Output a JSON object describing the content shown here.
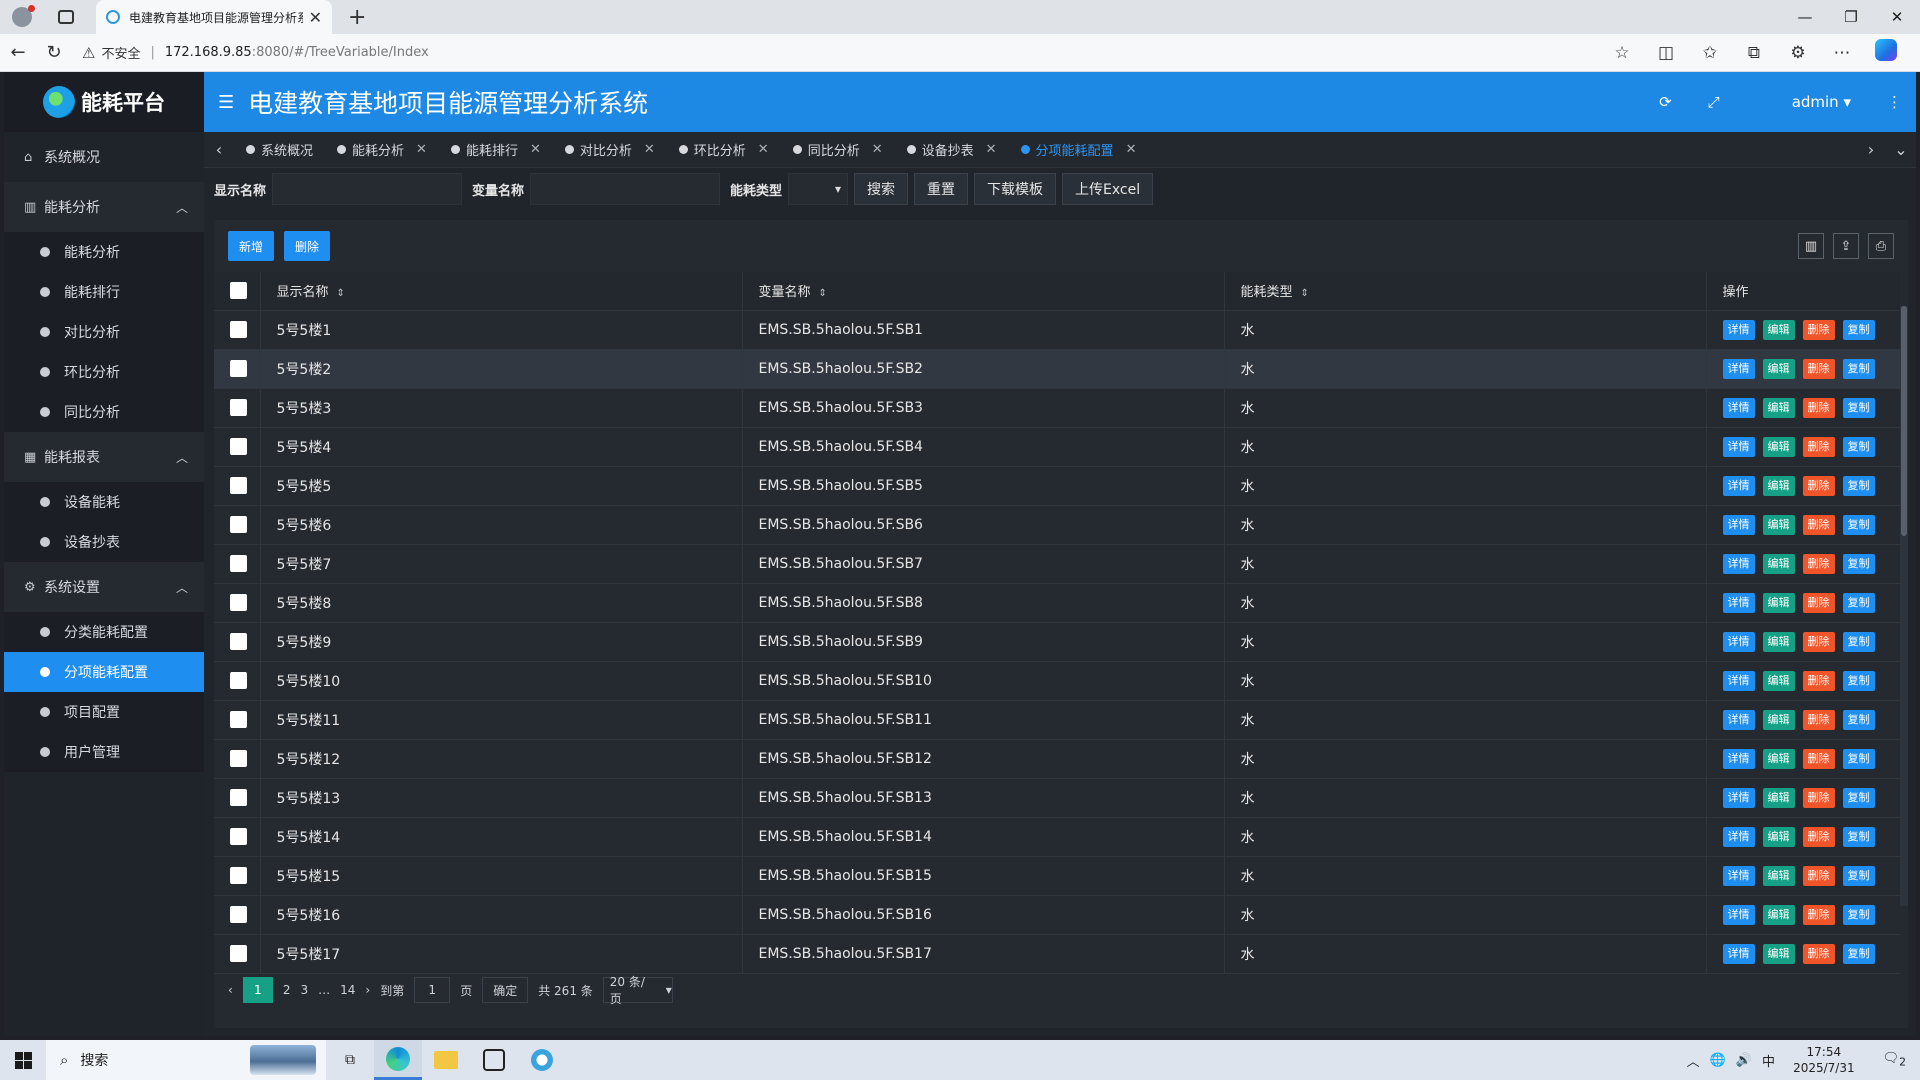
{
  "browser": {
    "tab_title": "电建教育基地项目能源管理分析系",
    "new_tab": "+",
    "security_text": "不安全",
    "url_host": "172.168.9.85",
    "url_path": ":8080/#/TreeVariable/Index"
  },
  "app": {
    "logo_text": "能耗平台",
    "system_title": "电建教育基地项目能源管理分析系统",
    "user": "admin"
  },
  "sidebar": {
    "overview": "系统概况",
    "group_analysis": "能耗分析",
    "analysis_items": [
      "能耗分析",
      "能耗排行",
      "对比分析",
      "环比分析",
      "同比分析"
    ],
    "group_report": "能耗报表",
    "report_items": [
      "设备能耗",
      "设备抄表"
    ],
    "group_settings": "系统设置",
    "settings_items": [
      "分类能耗配置",
      "分项能耗配置",
      "项目配置",
      "用户管理"
    ]
  },
  "tags": [
    "系统概况",
    "能耗分析",
    "能耗排行",
    "对比分析",
    "环比分析",
    "同比分析",
    "设备抄表",
    "分项能耗配置"
  ],
  "search": {
    "display_name_label": "显示名称",
    "variable_name_label": "变量名称",
    "energy_type_label": "能耗类型",
    "search_btn": "搜索",
    "reset_btn": "重置",
    "download_btn": "下载模板",
    "upload_btn": "上传Excel"
  },
  "toolbar": {
    "add_btn": "新增",
    "delete_btn": "删除"
  },
  "table": {
    "headers": [
      "显示名称",
      "变量名称",
      "能耗类型",
      "操作"
    ],
    "ops": [
      "详情",
      "编辑",
      "删除",
      "复制"
    ],
    "rows": [
      [
        "5号5楼1",
        "EMS.SB.5haolou.5F.SB1",
        "水"
      ],
      [
        "5号5楼2",
        "EMS.SB.5haolou.5F.SB2",
        "水"
      ],
      [
        "5号5楼3",
        "EMS.SB.5haolou.5F.SB3",
        "水"
      ],
      [
        "5号5楼4",
        "EMS.SB.5haolou.5F.SB4",
        "水"
      ],
      [
        "5号5楼5",
        "EMS.SB.5haolou.5F.SB5",
        "水"
      ],
      [
        "5号5楼6",
        "EMS.SB.5haolou.5F.SB6",
        "水"
      ],
      [
        "5号5楼7",
        "EMS.SB.5haolou.5F.SB7",
        "水"
      ],
      [
        "5号5楼8",
        "EMS.SB.5haolou.5F.SB8",
        "水"
      ],
      [
        "5号5楼9",
        "EMS.SB.5haolou.5F.SB9",
        "水"
      ],
      [
        "5号5楼10",
        "EMS.SB.5haolou.5F.SB10",
        "水"
      ],
      [
        "5号5楼11",
        "EMS.SB.5haolou.5F.SB11",
        "水"
      ],
      [
        "5号5楼12",
        "EMS.SB.5haolou.5F.SB12",
        "水"
      ],
      [
        "5号5楼13",
        "EMS.SB.5haolou.5F.SB13",
        "水"
      ],
      [
        "5号5楼14",
        "EMS.SB.5haolou.5F.SB14",
        "水"
      ],
      [
        "5号5楼15",
        "EMS.SB.5haolou.5F.SB15",
        "水"
      ],
      [
        "5号5楼16",
        "EMS.SB.5haolou.5F.SB16",
        "水"
      ],
      [
        "5号5楼17",
        "EMS.SB.5haolou.5F.SB17",
        "水"
      ]
    ]
  },
  "pager": {
    "pages": [
      "1",
      "2",
      "3",
      "…",
      "14"
    ],
    "goto_label": "到第",
    "goto_value": "1",
    "page_unit": "页",
    "confirm": "确定",
    "total": "共 261 条",
    "page_size": "20 条/页"
  },
  "taskbar": {
    "search_text": "搜索",
    "ime": "中",
    "time": "17:54",
    "date": "2025/7/31",
    "notif_count": "2"
  },
  "colors": {
    "accent": "#1e88e5",
    "active_menu": "#1f8ef1",
    "edit": "#16a085",
    "delete": "#f0552a"
  }
}
